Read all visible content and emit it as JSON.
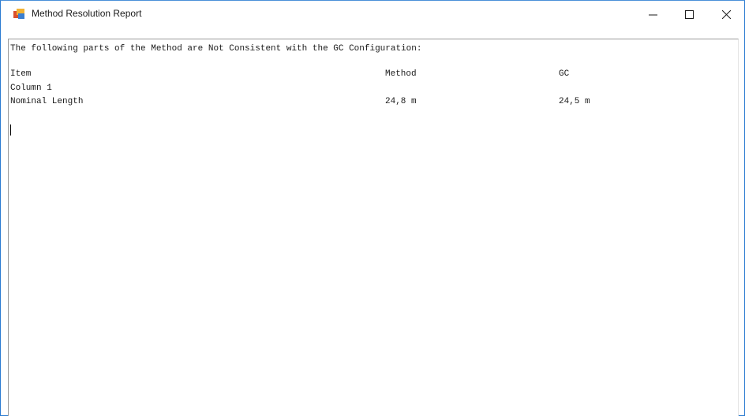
{
  "window": {
    "title": "Method Resolution Report"
  },
  "controls": {
    "minimize_icon": "minimize-icon",
    "maximize_icon": "maximize-icon",
    "close_icon": "close-icon"
  },
  "report": {
    "intro": "The following parts of the Method are Not Consistent with the GC Configuration:",
    "headers": {
      "item": "Item",
      "method": "Method",
      "gc": "GC"
    },
    "rows": [
      {
        "item": "Column 1",
        "method": "",
        "gc": ""
      },
      {
        "item": "Nominal Length",
        "method": "24,8 m",
        "gc": "24,5 m"
      }
    ]
  },
  "colors": {
    "window_border": "#2b7bd1",
    "text": "#1a1a1a",
    "background": "#ffffff"
  }
}
